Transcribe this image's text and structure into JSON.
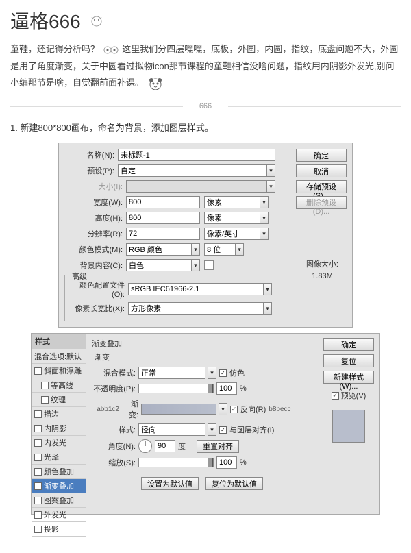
{
  "header": {
    "title": "逼格666"
  },
  "desc": {
    "p1a": "童鞋，还记得分析吗？",
    "p1b": "这里我们分四层嘿嘿，底板，外圆，内圆，指纹，底盘问题不大，外圆是用了角度渐变，关于中圆看过拟物icon那节课程的童鞋相信没啥问题，指纹用内阴影外发光,别问小编那节是啥，自觉翻前面补课。"
  },
  "divider": "666",
  "step1": "1. 新建800*800画布，命名为背景，添加图层样式。",
  "dlg1": {
    "name_lbl": "名称(N):",
    "name_val": "未标题-1",
    "preset_lbl": "预设(P):",
    "preset_val": "自定",
    "size_lbl": "大小(I):",
    "width_lbl": "宽度(W):",
    "width_val": "800",
    "width_unit": "像素",
    "height_lbl": "高度(H):",
    "height_val": "800",
    "height_unit": "像素",
    "res_lbl": "分辨率(R):",
    "res_val": "72",
    "res_unit": "像素/英寸",
    "mode_lbl": "颜色模式(M):",
    "mode_val": "RGB 颜色",
    "mode_bit": "8 位",
    "bg_lbl": "背景内容(C):",
    "bg_val": "白色",
    "adv_legend": "高级",
    "profile_lbl": "颜色配置文件(O):",
    "profile_val": "sRGB IEC61966-2.1",
    "aspect_lbl": "像素长宽比(X):",
    "aspect_val": "方形像素",
    "ok": "确定",
    "cancel": "取消",
    "save_preset": "存储预设(S)...",
    "del_preset": "删除预设(D)...",
    "imgsize_lbl": "图像大小:",
    "imgsize_val": "1.83M"
  },
  "dlg2": {
    "styles_hdr": "样式",
    "blend_hdr": "混合选项:默认",
    "items": [
      "斜面和浮雕",
      "等高线",
      "纹理",
      "描边",
      "内阴影",
      "内发光",
      "光泽",
      "颜色叠加",
      "渐变叠加",
      "图案叠加",
      "外发光",
      "投影"
    ],
    "active_idx": 8,
    "panel_title": "渐变叠加",
    "panel_sub": "渐变",
    "blendmode_lbl": "混合模式:",
    "blendmode_val": "正常",
    "dither_lbl": "仿色",
    "opacity_lbl": "不透明度(P):",
    "opacity_val": "100",
    "pct": "%",
    "grad_lbl": "渐变:",
    "c1": "abb1c2",
    "c2": "b8becc",
    "reverse_lbl": "反向(R)",
    "style_lbl": "样式:",
    "style_val": "径向",
    "align_lbl": "与图层对齐(I)",
    "angle_lbl": "角度(N):",
    "angle_val": "90",
    "deg": "度",
    "reset_align": "重置对齐",
    "scale_lbl": "缩放(S):",
    "scale_val": "100",
    "set_default": "设置为默认值",
    "reset_default": "复位为默认值",
    "ok": "确定",
    "reset": "复位",
    "new_style": "新建样式(W)...",
    "preview": "预览(V)"
  }
}
